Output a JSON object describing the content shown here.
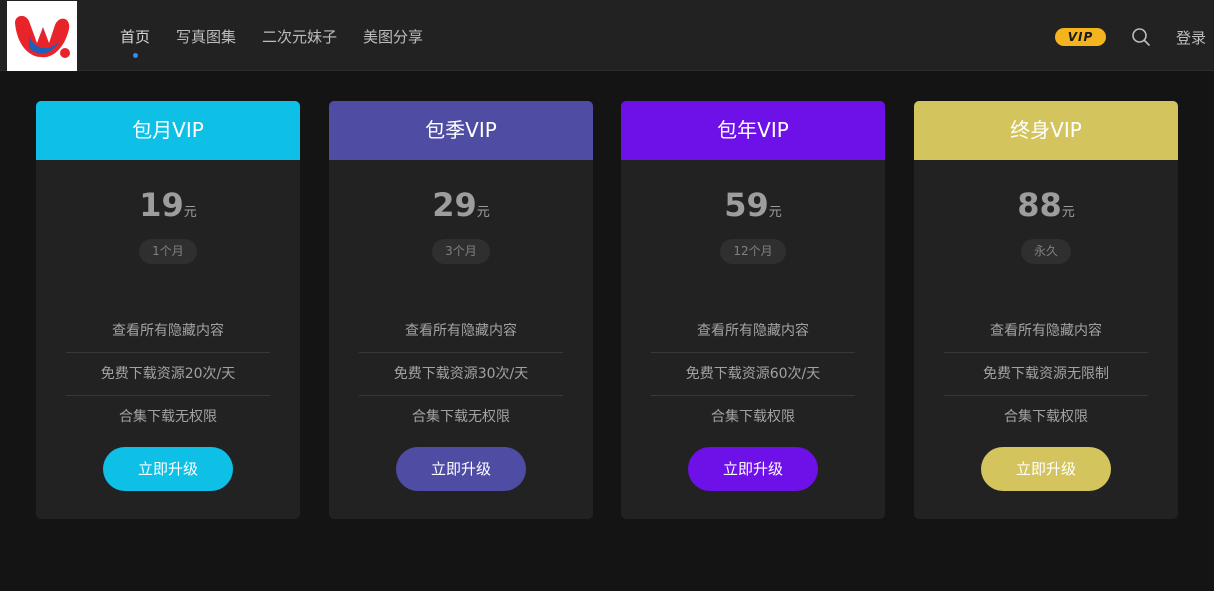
{
  "header": {
    "nav": [
      "首页",
      "写真图集",
      "二次元妹子",
      "美图分享"
    ],
    "vip_badge": "VIP",
    "login": "登录",
    "colors": {
      "active_dot": "#2a8fef",
      "vip_badge": "#f5b41d"
    }
  },
  "plans": [
    {
      "name": "包月VIP",
      "price": "19",
      "unit": "元",
      "period": "1个月",
      "features": [
        "查看所有隐藏内容",
        "免费下载资源20次/天",
        "合集下载无权限"
      ],
      "button": "立即升级",
      "color": "#0ec0e6"
    },
    {
      "name": "包季VIP",
      "price": "29",
      "unit": "元",
      "period": "3个月",
      "features": [
        "查看所有隐藏内容",
        "免费下载资源30次/天",
        "合集下载无权限"
      ],
      "button": "立即升级",
      "color": "#4f4da3"
    },
    {
      "name": "包年VIP",
      "price": "59",
      "unit": "元",
      "period": "12个月",
      "features": [
        "查看所有隐藏内容",
        "免费下载资源60次/天",
        "合集下载权限"
      ],
      "button": "立即升级",
      "color": "#6e10e8"
    },
    {
      "name": "终身VIP",
      "price": "88",
      "unit": "元",
      "period": "永久",
      "features": [
        "查看所有隐藏内容",
        "免费下载资源无限制",
        "合集下载权限"
      ],
      "button": "立即升级",
      "color": "#d4c45e"
    }
  ]
}
